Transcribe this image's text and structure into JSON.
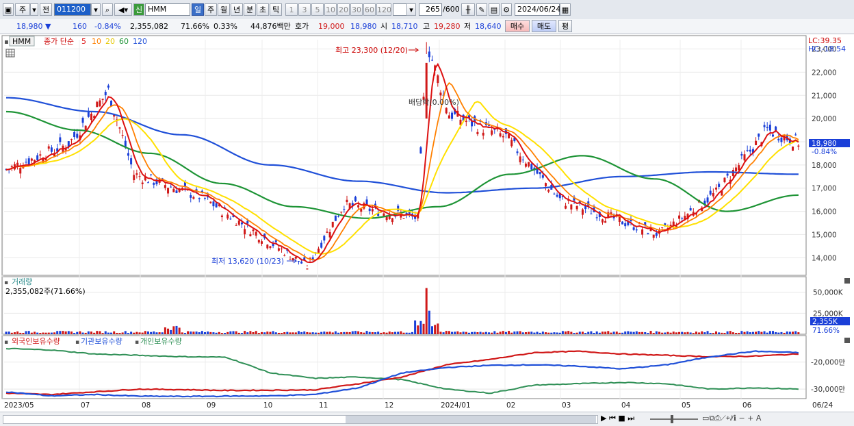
{
  "toolbar": {
    "market_label": "주",
    "type_label": "전",
    "code": "011200",
    "new_badge": "신",
    "name": "HMM",
    "periods": [
      "일",
      "주",
      "월",
      "년",
      "분",
      "초",
      "틱"
    ],
    "active_period": "일",
    "multipliers": [
      "1",
      "3",
      "5",
      "10",
      "20",
      "30",
      "60",
      "120"
    ],
    "count": "265",
    "count_max": "/600",
    "date": "2024/06/24"
  },
  "quote": {
    "price": "18,980",
    "arrow": "▼",
    "change": "160",
    "change_pct": "-0.84%",
    "volume": "2,355,082",
    "vol_ratio": "71.66%",
    "turnover": "0.33%",
    "amount": "44,876백만",
    "ask_label": "호가",
    "ask": "19,000",
    "bid": "18,980",
    "open_label": "시",
    "open": "18,710",
    "high_label": "고",
    "high": "19,280",
    "low_label": "저",
    "low": "18,640",
    "buy_label": "매수",
    "sell_label": "매도",
    "avg_label": "평"
  },
  "price_legend": {
    "name": "HMM",
    "ma_label": "종가 단순",
    "ma_periods": [
      "5",
      "10",
      "20",
      "60",
      "120"
    ]
  },
  "annotations": {
    "high": "최고 23,300 (12/20)",
    "low": "최저 13,620 (10/23)",
    "dividend": "배당락(0.00%)",
    "lc": "LC:39.35",
    "hc": "HC:-18.54",
    "price_tag": "18,980",
    "pct_tag": "-0.84%"
  },
  "volume_legend": {
    "title": "거래량",
    "value": "2,355,082주(71.66%)",
    "tag": "2,355K",
    "tag_pct": "71.66%"
  },
  "holdings_legend": [
    "외국인보유수량",
    "기관보유수량",
    "개인보유수량"
  ],
  "colors": {
    "up": "#d01818",
    "down": "#1a3fd8",
    "ma5": "#dd1111",
    "ma10": "#ff8000",
    "ma20": "#ffe000",
    "ma60": "#1e9436",
    "ma120": "#2050d8",
    "foreign": "#d01818",
    "inst": "#2050d8",
    "indiv": "#2e8f55"
  },
  "chart_data": [
    {
      "type": "candlestick",
      "title": "HMM",
      "ylim": [
        13300,
        23400
      ],
      "y_ticks": [
        "14,000",
        "15,000",
        "16,000",
        "17,000",
        "18,000",
        "19,000",
        "20,000",
        "21,000",
        "22,000",
        "23,000"
      ],
      "x_tick_labels": [
        "2023/05",
        "07",
        "08",
        "09",
        "10",
        "11",
        "12",
        "2024/01",
        "02",
        "03",
        "04",
        "05",
        "06",
        "06/24"
      ],
      "series_close_anchors": [
        {
          "date": "2023/05",
          "close": 17800
        },
        {
          "date": "2023/07",
          "close": 18900
        },
        {
          "date": "2023/07",
          "close": 21200
        },
        {
          "date": "2023/08",
          "close": 17600
        },
        {
          "date": "2023/09",
          "close": 16600
        },
        {
          "date": "2023/10/23",
          "close": 13620
        },
        {
          "date": "2023/11",
          "close": 16300
        },
        {
          "date": "2023/12",
          "close": 15700
        },
        {
          "date": "2023/12/20",
          "close": 23300
        },
        {
          "date": "2024/01",
          "close": 20200
        },
        {
          "date": "2024/02",
          "close": 19200
        },
        {
          "date": "2024/03",
          "close": 16500
        },
        {
          "date": "2024/04",
          "close": 15000
        },
        {
          "date": "2024/05",
          "close": 16800
        },
        {
          "date": "2024/06",
          "close": 19500
        },
        {
          "date": "2024/06/24",
          "close": 18980
        }
      ],
      "ma120_anchors": [
        20900,
        20300,
        19300,
        18000,
        17300,
        16800,
        17000,
        17500,
        17700,
        17600
      ],
      "ma60_anchors": [
        20300,
        19500,
        18500,
        17200,
        16200,
        15700,
        16200,
        17600,
        18400,
        17400,
        16000,
        16700
      ]
    },
    {
      "type": "bar",
      "title": "거래량",
      "y_ticks": [
        "25,000K",
        "50,000K"
      ],
      "last": "2,355,082"
    },
    {
      "type": "line",
      "series": [
        {
          "name": "외국인보유수량"
        },
        {
          "name": "기관보유수량"
        },
        {
          "name": "개인보유수량"
        }
      ],
      "y_ticks": [
        "-30,000만",
        "-20,000만"
      ]
    }
  ]
}
